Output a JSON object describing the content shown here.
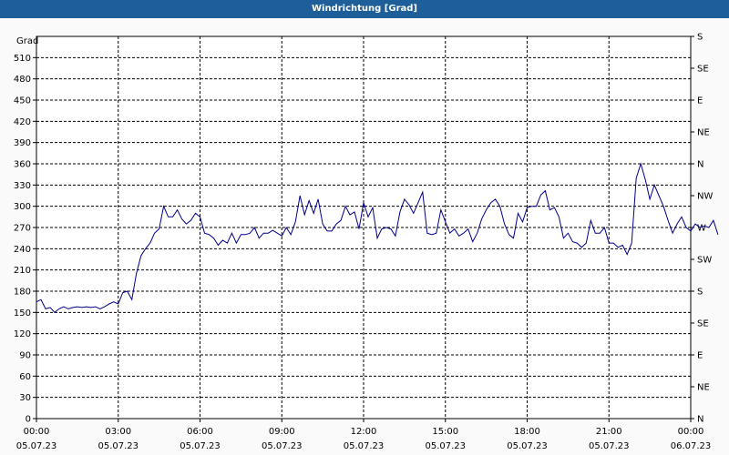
{
  "window": {
    "title": "Windrichtung [Grad]"
  },
  "chart_data": {
    "type": "line",
    "title": "Windrichtung [Grad]",
    "ylabel": "Grad",
    "ylim": [
      0,
      540
    ],
    "y_ticks": [
      0,
      30,
      60,
      90,
      120,
      150,
      180,
      210,
      240,
      270,
      300,
      330,
      360,
      390,
      420,
      450,
      480,
      510
    ],
    "y2_ticks": [
      "N",
      "NE",
      "E",
      "SE",
      "S",
      "SW",
      "W",
      "NW",
      "N",
      "NE",
      "E",
      "SE",
      "S"
    ],
    "x_ticks": [
      {
        "time": "00:00",
        "date": "05.07.23"
      },
      {
        "time": "03:00",
        "date": "05.07.23"
      },
      {
        "time": "06:00",
        "date": "05.07.23"
      },
      {
        "time": "09:00",
        "date": "05.07.23"
      },
      {
        "time": "12:00",
        "date": "05.07.23"
      },
      {
        "time": "15:00",
        "date": "05.07.23"
      },
      {
        "time": "18:00",
        "date": "05.07.23"
      },
      {
        "time": "21:00",
        "date": "05.07.23"
      },
      {
        "time": "00:00",
        "date": "06.07.23"
      }
    ],
    "grid": true,
    "line_color": "#00008b",
    "series": [
      {
        "x_step_minutes": 10,
        "values": [
          165,
          168,
          155,
          157,
          150,
          155,
          158,
          155,
          157,
          158,
          157,
          158,
          157,
          158,
          155,
          158,
          162,
          165,
          162,
          178,
          180,
          168,
          205,
          230,
          240,
          248,
          262,
          268,
          300,
          285,
          285,
          295,
          282,
          275,
          280,
          290,
          285,
          262,
          260,
          255,
          245,
          252,
          248,
          262,
          248,
          260,
          260,
          262,
          270,
          255,
          262,
          262,
          266,
          262,
          258,
          270,
          260,
          278,
          315,
          288,
          308,
          290,
          310,
          275,
          265,
          265,
          275,
          280,
          300,
          288,
          292,
          268,
          305,
          285,
          298,
          255,
          268,
          270,
          268,
          258,
          292,
          310,
          302,
          290,
          305,
          320,
          262,
          260,
          262,
          295,
          278,
          262,
          268,
          258,
          262,
          268,
          250,
          262,
          282,
          295,
          305,
          310,
          300,
          275,
          260,
          255,
          290,
          278,
          298,
          300,
          300,
          316,
          322,
          295,
          298,
          285,
          255,
          262,
          250,
          248,
          242,
          248,
          280,
          262,
          262,
          270,
          248,
          248,
          242,
          245,
          232,
          248,
          340,
          360,
          338,
          310,
          330,
          315,
          300,
          280,
          262,
          275,
          285,
          270,
          265,
          275,
          270,
          272,
          270,
          280,
          260
        ]
      }
    ]
  }
}
